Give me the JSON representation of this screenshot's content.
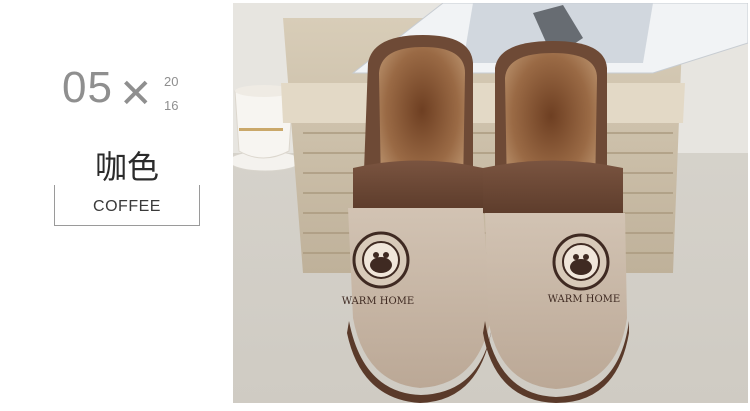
{
  "index": {
    "number": "05",
    "separator": "✕",
    "year_top": "20",
    "year_bottom": "16"
  },
  "color_label": {
    "chinese": "咖色",
    "english": "COFFEE"
  },
  "slipper_text": {
    "left_badge": "WARM HOME",
    "right_badge": "WARM HOME"
  },
  "colors": {
    "slipper_body": "#c7b7a6",
    "slipper_band": "#6e4a36",
    "fur_lining": "#8a5a3a",
    "logo": "#3f2a22"
  }
}
